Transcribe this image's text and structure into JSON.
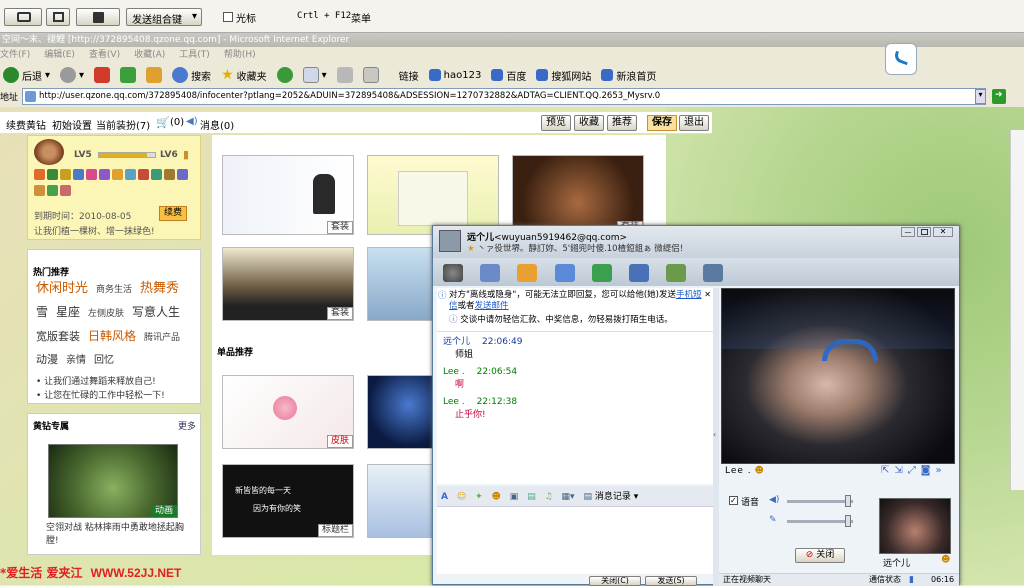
{
  "top_toolbar": {
    "send_combo": "发送组合键",
    "cursor_label": "光标",
    "shortcut": "Crtl + F12",
    "menu_label": "菜单"
  },
  "ie": {
    "title": "空间～末、褪鲤 [http://372895408.qzone.qq.com] - Microsoft Internet Explorer",
    "menu": [
      "文件(F)",
      "编辑(E)",
      "查看(V)",
      "收藏(A)",
      "工具(T)",
      "帮助(H)"
    ],
    "toolbar": {
      "back": "后退",
      "search": "搜索",
      "favorites": "收藏夹"
    },
    "links_label": "链接",
    "links": [
      "hao123",
      "百度",
      "搜狐网站",
      "新浪首页"
    ],
    "address_label": "地址",
    "address": "http://user.qzone.qq.com/372895408/infocenter?ptlang=2052&ADUIN=372895408&ADSESSION=1270732882&ADTAG=CLIENT.QQ.2653_Mysrv.0"
  },
  "qzone_bar": {
    "left": [
      "续费黄钻",
      "初始设置"
    ],
    "current": "当前装扮(7)",
    "cart": "(0)",
    "msg": "消息(0)",
    "right": [
      "预览",
      "收藏",
      "推荐"
    ],
    "save": "保存",
    "exit": "退出"
  },
  "profile": {
    "level_left": "LV5",
    "level_right": "LV6",
    "expire": "到期时间：2010-08-05",
    "renew": "续费",
    "slogan": "让我们植一棵树、增一抹绿色!"
  },
  "hot": {
    "title": "热门推荐",
    "tags": [
      [
        "休闲时光",
        "#c85a00",
        13
      ],
      [
        "商务生活",
        "#444",
        9
      ],
      [
        "热舞秀",
        "#c85a00",
        13
      ],
      [
        "雪",
        "#333",
        12
      ],
      [
        "星座",
        "#333",
        12
      ],
      [
        "左侧皮肤",
        "#444",
        9
      ],
      [
        "写意人生",
        "#333",
        12
      ],
      [
        "宽版套装",
        "#333",
        11
      ],
      [
        "日韩风格",
        "#c85a00",
        12
      ],
      [
        "腾讯产品",
        "#444",
        9
      ],
      [
        "动漫",
        "#333",
        11
      ],
      [
        "亲情",
        "#333",
        10
      ],
      [
        "回忆",
        "#333",
        10
      ]
    ],
    "lines": [
      "让我们通过舞蹈来释放自己!",
      "让您在忙碌的工作中轻松一下!"
    ]
  },
  "vip": {
    "title": "黄钻专属",
    "more": "更多",
    "anim": "动画",
    "desc": "空翎对战 粘林摔雨中勇敢地拯起胸膛!"
  },
  "gallery": {
    "suit": "套装",
    "single_title": "单品推荐",
    "skin": "皮肤",
    "title_bar": "标题栏",
    "card_text_1": "新皆皆的每一天",
    "card_text_2": "因为有你的笑"
  },
  "qq": {
    "name": "远个儿",
    "email": "<wuyuan5919462@qq.com>",
    "status": "丶ァ役世堺。靜訂妳、5'鎺兜吋傻.10楂鋀鉏ぁ 微缇侣!",
    "notice_1": "对方\"离线或隐身\"，可能无法立即回复，您可以给他(她)发送",
    "notice_link_1": "手机短信",
    "notice_or": "或者",
    "notice_link_2": "发送邮件",
    "safety": "交谈中请勿轻信汇款、中奖信息，勿轻易拨打陌生电话。",
    "msgs": [
      {
        "name": "远个儿",
        "time": "22:06:49",
        "text": "师姐",
        "ncol": "#1a3a9a",
        "tcol": "#000"
      },
      {
        "name": "Lee .",
        "time": "22:06:54",
        "text": "啊",
        "ncol": "#007a00",
        "tcol": "#c8003c"
      },
      {
        "name": "Lee .",
        "time": "22:12:38",
        "text": "止乎你!",
        "ncol": "#007a00",
        "tcol": "#c8003c"
      }
    ],
    "history": "消息记录",
    "close_btn": "关闭(C)",
    "send_btn": "发送(S)",
    "video_name": "Lee .",
    "voice": "语音",
    "hangup": "关闭",
    "small_name": "远个儿",
    "video_status": "正在视频聊天",
    "net_status": "通信状态",
    "clock": "06:16"
  },
  "watermark": {
    "part1": "*爱生活 爱夹江",
    "part2": "WWW.52JJ.NET"
  }
}
